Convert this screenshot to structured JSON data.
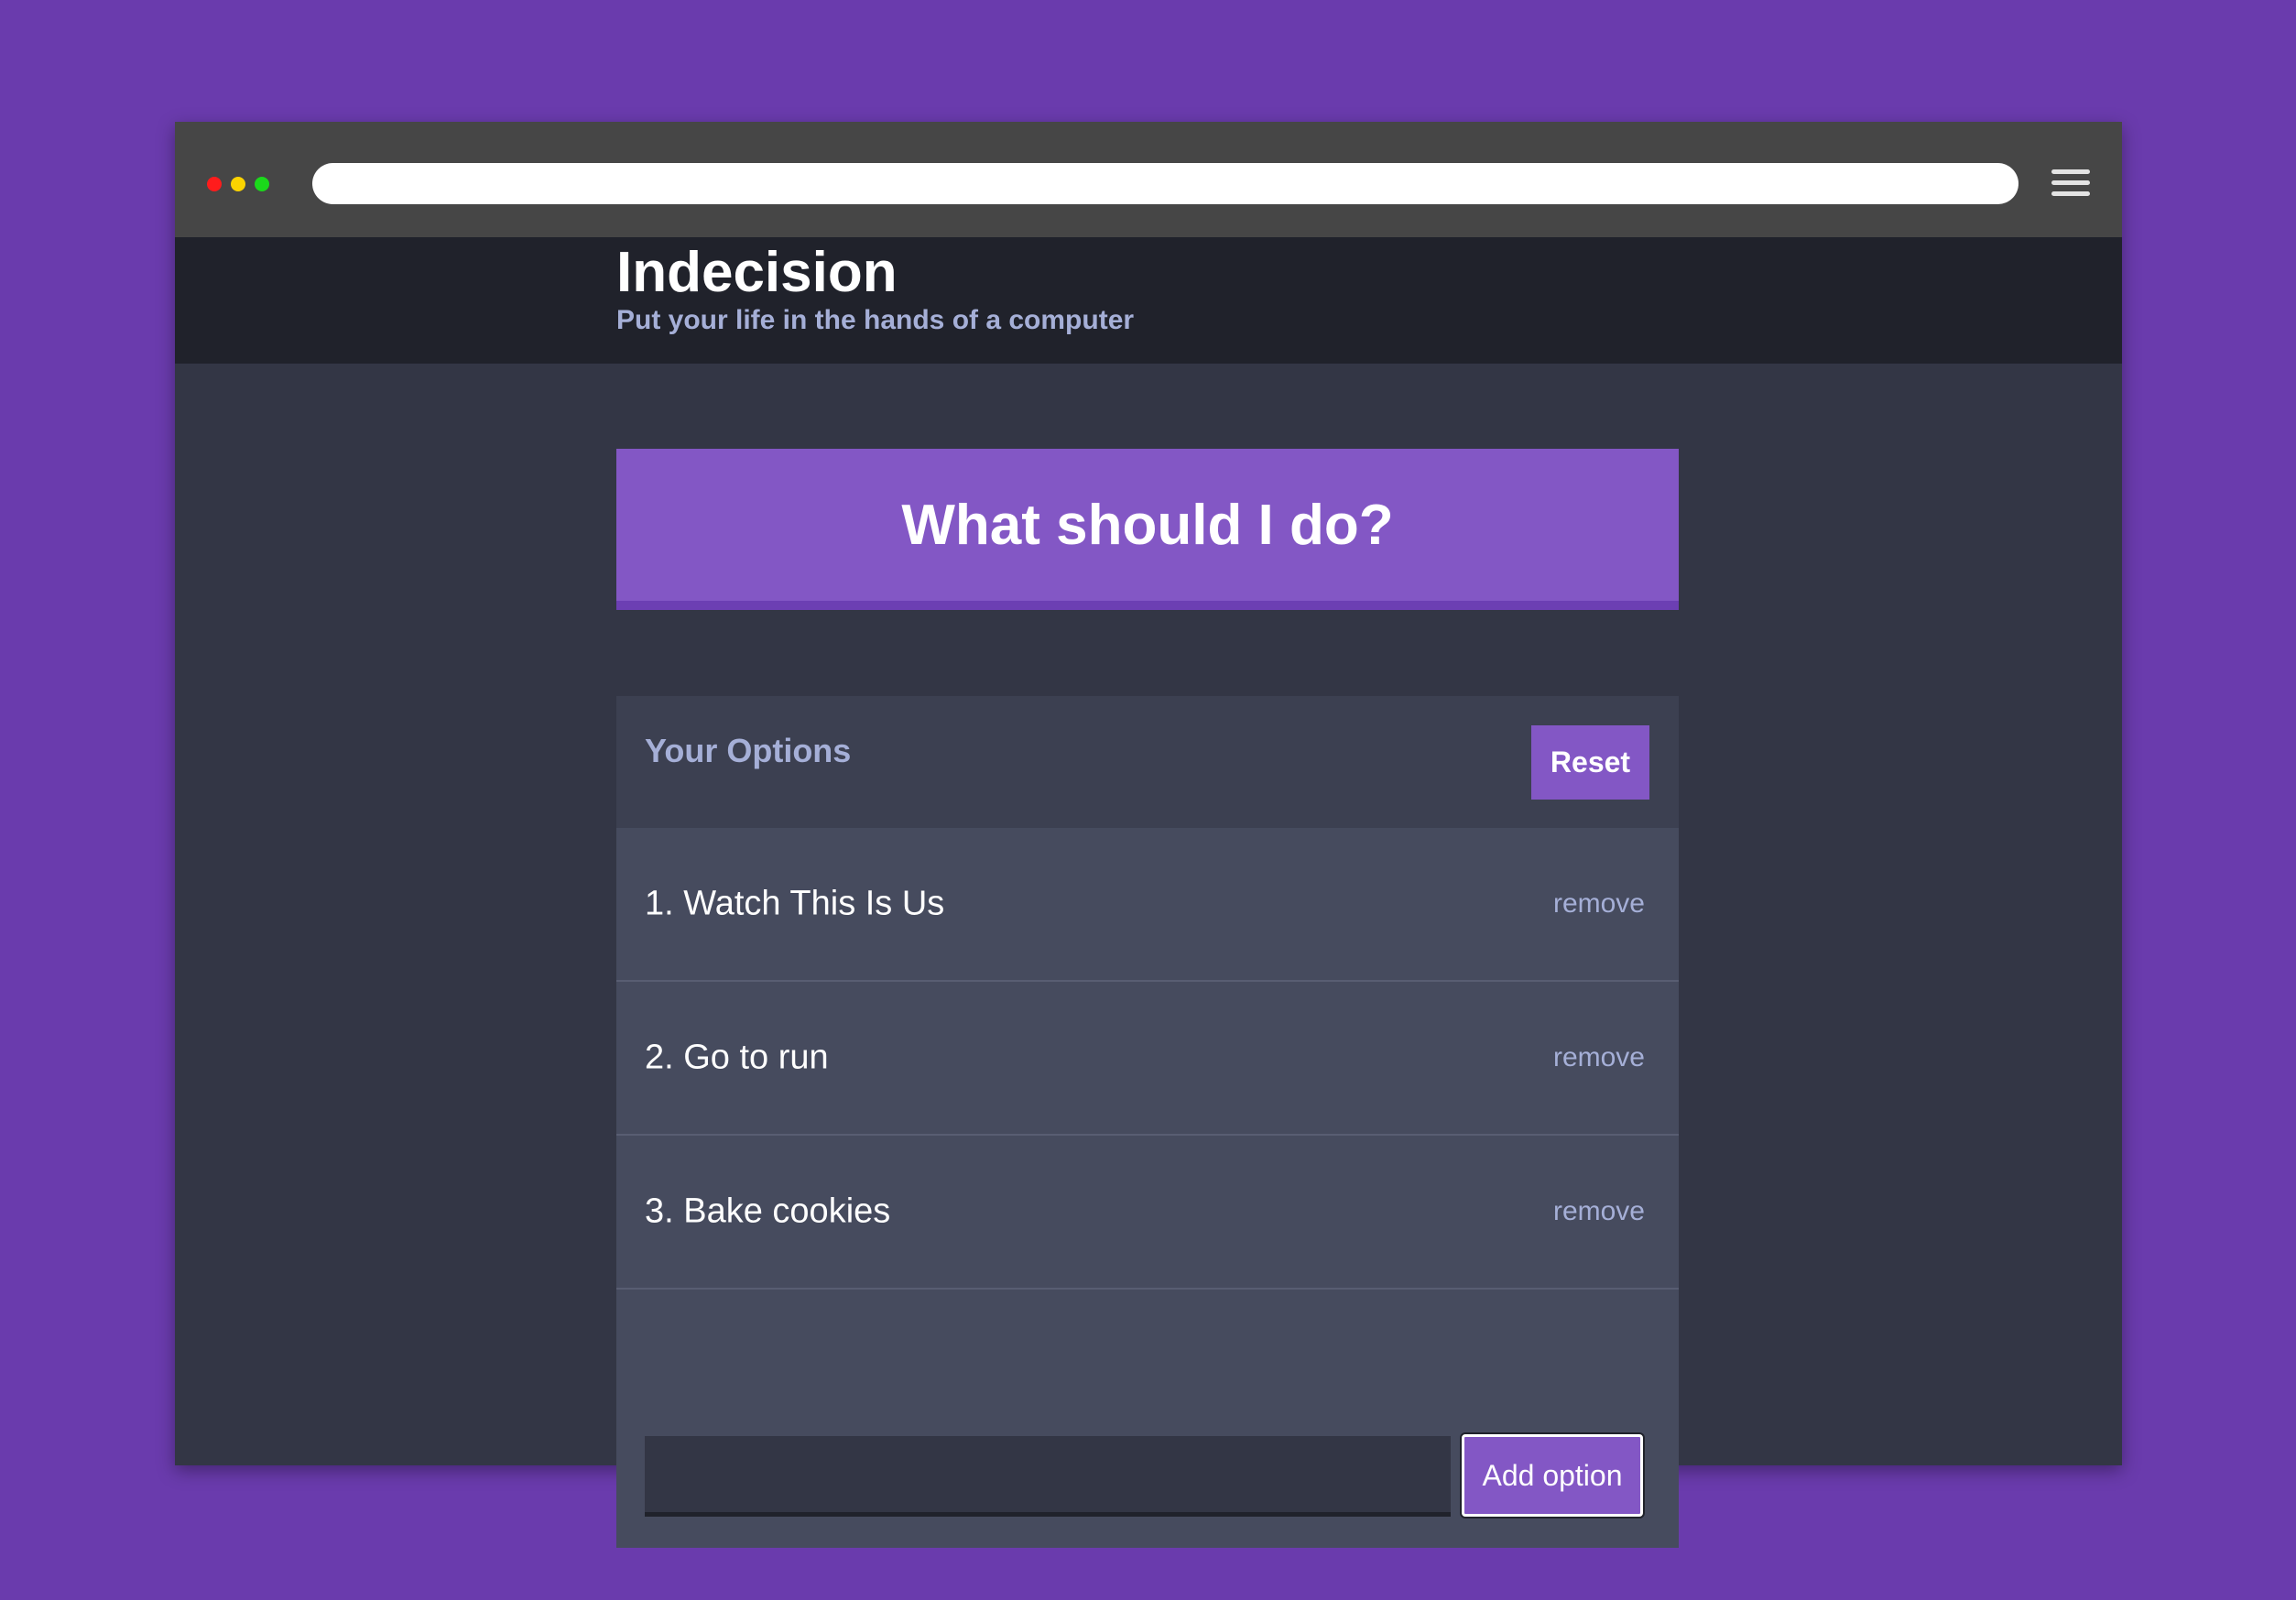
{
  "browser": {
    "traffic_lights": [
      "red",
      "yellow",
      "green"
    ],
    "url": "",
    "menu_icon": "hamburger-menu-icon"
  },
  "header": {
    "title": "Indecision",
    "subtitle": "Put your life in the hands of a computer"
  },
  "main": {
    "decide_button_label": "What should I do?"
  },
  "options_widget": {
    "title": "Your Options",
    "reset_label": "Reset",
    "options": [
      {
        "text": "1. Watch This Is Us",
        "remove_label": "remove"
      },
      {
        "text": "2. Go to run",
        "remove_label": "remove"
      },
      {
        "text": "3. Bake cookies",
        "remove_label": "remove"
      }
    ],
    "add_input_value": "",
    "add_button_label": "Add option"
  },
  "colors": {
    "page_background": "#6a3bad",
    "header_background": "#20222b",
    "content_background": "#333645",
    "accent_purple": "#8357c5",
    "muted_text": "#a5afd7"
  }
}
